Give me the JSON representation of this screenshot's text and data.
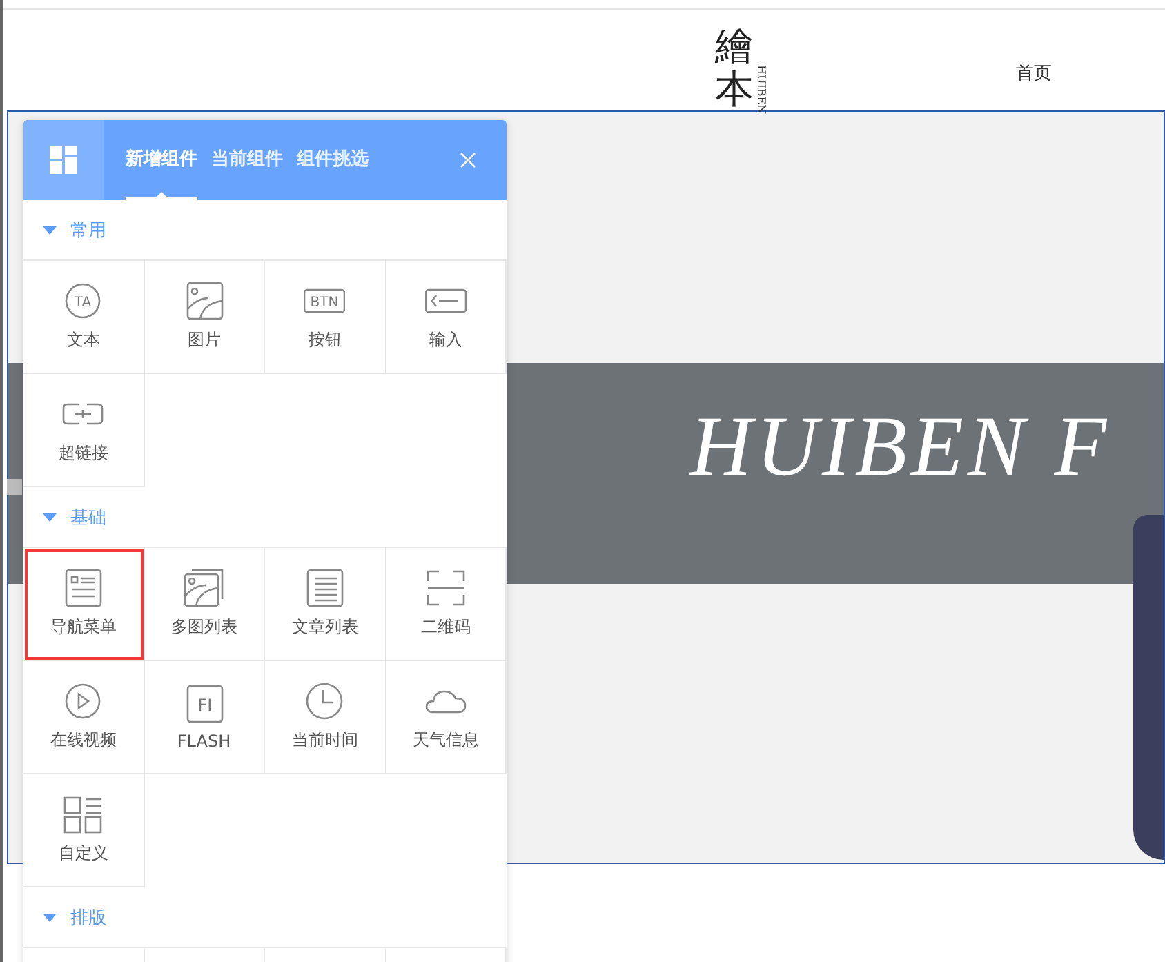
{
  "site": {
    "logo": {
      "title": "繪本",
      "subtitle": "HUIBEN"
    },
    "nav": [
      {
        "label": "首页"
      }
    ],
    "banner": {
      "headline": "HUIBEN F"
    }
  },
  "panel": {
    "tabs": [
      {
        "label": "新增组件",
        "selected": true
      },
      {
        "label": "当前组件",
        "selected": false
      },
      {
        "label": "组件挑选",
        "selected": false
      }
    ],
    "sections": [
      {
        "title": "常用",
        "expanded": true,
        "items": [
          {
            "label": "文本",
            "kind": "text",
            "icon_text": "TA",
            "selected": false
          },
          {
            "label": "图片",
            "kind": "image",
            "selected": false
          },
          {
            "label": "按钮",
            "kind": "button",
            "icon_text": "BTN",
            "selected": false
          },
          {
            "label": "输入",
            "kind": "input",
            "selected": false
          },
          {
            "label": "超链接",
            "kind": "link",
            "selected": false
          }
        ]
      },
      {
        "title": "基础",
        "expanded": true,
        "items": [
          {
            "label": "导航菜单",
            "kind": "nav",
            "selected": true
          },
          {
            "label": "多图列表",
            "kind": "gallery",
            "selected": false
          },
          {
            "label": "文章列表",
            "kind": "article",
            "selected": false
          },
          {
            "label": "二维码",
            "kind": "qrcode",
            "selected": false
          },
          {
            "label": "在线视频",
            "kind": "video",
            "selected": false
          },
          {
            "label": "FLASH",
            "kind": "flash",
            "icon_text": "FI",
            "selected": false
          },
          {
            "label": "当前时间",
            "kind": "clock",
            "selected": false
          },
          {
            "label": "天气信息",
            "kind": "weather",
            "selected": false
          },
          {
            "label": "自定义",
            "kind": "custom",
            "selected": false
          }
        ]
      },
      {
        "title": "排版",
        "expanded": true
      }
    ]
  }
}
